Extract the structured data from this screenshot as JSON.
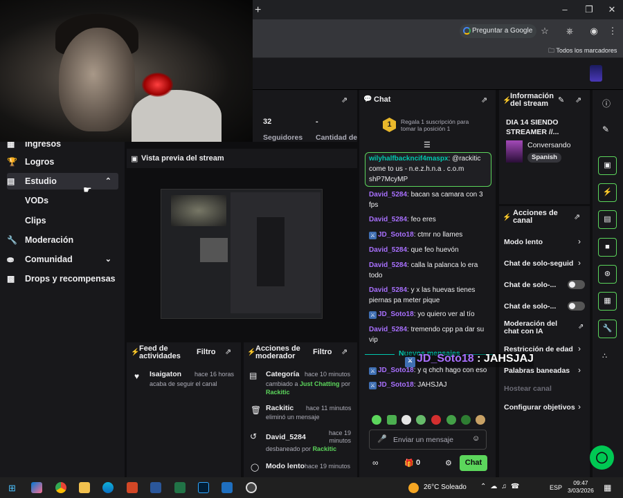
{
  "browser": {
    "new_tab": "+",
    "google_button": "Preguntar a Google",
    "bookmarks_folder": "Todos los marcadores"
  },
  "sidebar": {
    "items": [
      {
        "label": "Ingresos",
        "icon": "money-icon"
      },
      {
        "label": "Logros",
        "icon": "trophy-icon"
      },
      {
        "label": "Estudio",
        "icon": "studio-icon"
      },
      {
        "label": "VODs"
      },
      {
        "label": "Clips"
      },
      {
        "label": "Moderación",
        "icon": "wrench-icon"
      },
      {
        "label": "Comunidad",
        "icon": "community-icon"
      },
      {
        "label": "Drops y recompensas",
        "icon": "drops-icon"
      }
    ]
  },
  "stats": {
    "followers_value": "32",
    "followers_label": "Seguidores",
    "subs_value": "-",
    "subs_label": "Cantidad de"
  },
  "preview": {
    "title": "Vista previa del stream"
  },
  "feed": {
    "title": "Feed de actividades",
    "filter": "Filtro",
    "items": [
      {
        "user": "Isaigaton",
        "time": "hace 16 horas",
        "text": "acaba de seguir el canal"
      }
    ]
  },
  "mod_actions": {
    "title": "Acciones de moderador",
    "filter": "Filtro",
    "items": [
      {
        "title": "Categoría",
        "time": "hace 10 minutos",
        "pre": "cambiado a ",
        "hl": "Just Chatting",
        "mid": " por ",
        "hl2": "Rackitic"
      },
      {
        "title": "Rackitic",
        "time": "hace 11 minutos",
        "text": "eliminó un mensaje"
      },
      {
        "title": "David_5284",
        "time": "hace 19 minutos",
        "pre": "desbaneado por ",
        "hl": "Rackitic"
      },
      {
        "title": "Modo lento",
        "time": "hace 19 minutos"
      }
    ]
  },
  "chat": {
    "title": "Chat",
    "gift_rank": "1",
    "gift_text": "Regala 1 suscripción para tomar la posición 1",
    "highlight": {
      "user": "wilyhalfbackncif4maspx",
      "text": ": @rackitic come to us - n.e.z.h.n.a . c.o.m shP7McyMP"
    },
    "messages": [
      {
        "user": "David_5284",
        "text": ": bacan sa camara con 3 fps"
      },
      {
        "user": "David_5284",
        "text": ": feo eres"
      },
      {
        "user": "JD_Soto18",
        "text": ": ctmr no llames"
      },
      {
        "user": "David_5284",
        "text": ": que feo huevón"
      },
      {
        "user": "David_5284",
        "text": ": calla la palanca lo era todo"
      },
      {
        "user": "David_5284",
        "text": ": y x las huevas tienes piernas pa meter pique"
      },
      {
        "user": "JD_Soto18",
        "text": ": yo quiero ver al tío"
      },
      {
        "user": "David_5284",
        "text": ": tremendo cpp pa dar su vip"
      }
    ],
    "new_messages": "Nuevos mensajes",
    "after": [
      {
        "user": "JD_Soto18",
        "text": ": y q chch hago con eso"
      },
      {
        "user": "JD_Soto18",
        "text": ": JAHSJAJ"
      }
    ],
    "overlay_user": "JD_Soto18",
    "overlay_text": " : JAHSJAJ",
    "input_placeholder": "Enviar un mensaje",
    "points": "0",
    "send": "Chat"
  },
  "info": {
    "title": "Información del stream",
    "stream_title": "DIA 14 SIENDO STREAMER //...",
    "category": "Conversando",
    "language": "Spanish"
  },
  "actions": {
    "title": "Acciones de canal",
    "items": [
      {
        "label": "Modo lento",
        "kind": "chevron"
      },
      {
        "label": "Chat de solo-seguid",
        "kind": "chevron"
      },
      {
        "label": "Chat de solo-...",
        "kind": "toggle"
      },
      {
        "label": "Chat de solo-...",
        "kind": "toggle"
      },
      {
        "label": "Moderación del chat con IA",
        "kind": "external"
      },
      {
        "label": "Restricción de edad",
        "kind": "chevron"
      },
      {
        "label": "Palabras baneadas",
        "kind": "chevron"
      },
      {
        "label": "Hostear canal",
        "kind": "disabled"
      },
      {
        "label": "Configurar objetivos",
        "kind": "chevron"
      }
    ]
  },
  "taskbar": {
    "weather": "26°C  Soleado",
    "lang": "ESP",
    "time": "09:47",
    "date": "3/03/2026"
  },
  "colors": {
    "accent": "#5cd65c",
    "username": "#a970ff",
    "highlight": "#00c8af"
  }
}
